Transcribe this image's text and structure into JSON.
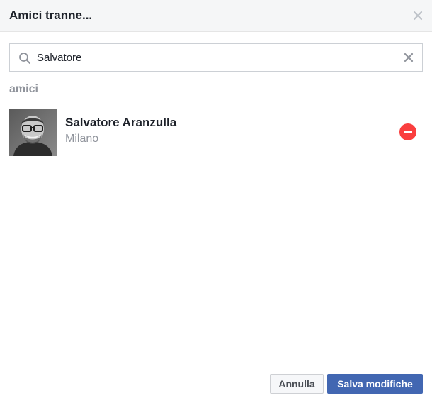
{
  "dialog": {
    "title": "Amici tranne...",
    "close_icon": "close-icon"
  },
  "search": {
    "value": "Salvatore",
    "search_icon": "search-icon",
    "clear_icon": "clear-icon"
  },
  "section": {
    "label": "amici"
  },
  "friends": [
    {
      "name": "Salvatore Aranzulla",
      "city": "Milano",
      "remove_icon": "remove-circle-icon"
    }
  ],
  "footer": {
    "cancel_label": "Annulla",
    "save_label": "Salva modifiche"
  },
  "colors": {
    "header_bg": "#f5f6f7",
    "primary_button": "#4267b2",
    "remove_red": "#fa3e3e",
    "muted_text": "#90949c"
  }
}
